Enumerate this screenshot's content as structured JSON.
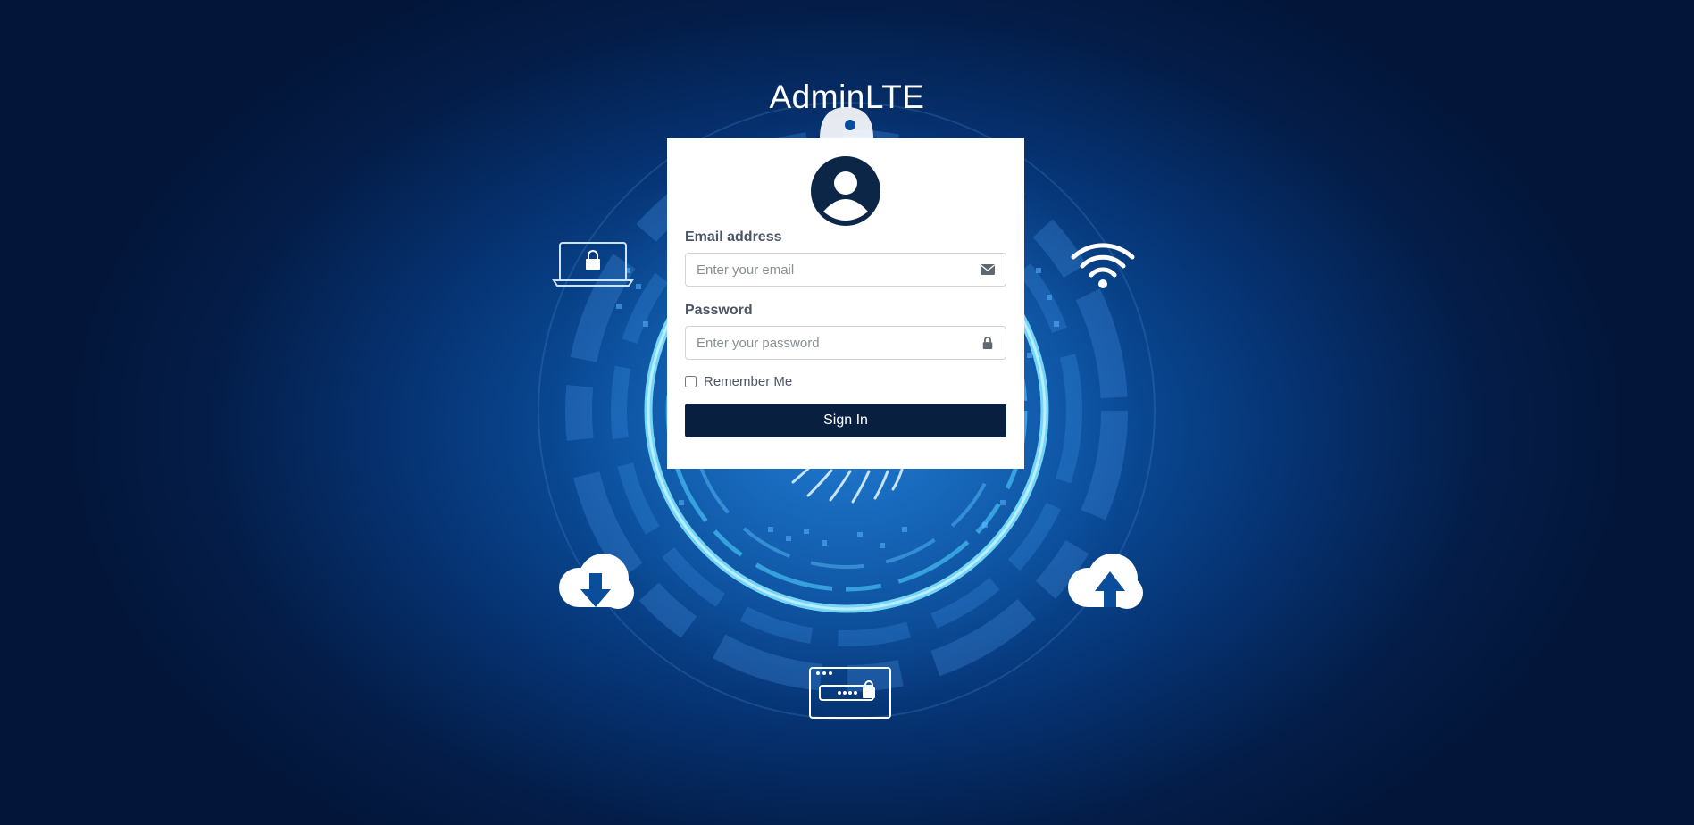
{
  "brand": {
    "title": "AdminLTE"
  },
  "login": {
    "avatar_icon": "user-circle-icon",
    "email": {
      "label": "Email address",
      "placeholder": "Enter your email",
      "value": "",
      "icon": "envelope-icon"
    },
    "password": {
      "label": "Password",
      "placeholder": "Enter your password",
      "value": "",
      "icon": "lock-icon"
    },
    "remember": {
      "label": "Remember Me",
      "checked": false
    },
    "submit_label": "Sign In"
  },
  "background": {
    "decor_icons": [
      "laptop-lock-icon",
      "wifi-icon",
      "cloud-download-icon",
      "cloud-upload-icon",
      "password-window-icon",
      "padlock-icon",
      "fingerprint-icon"
    ]
  },
  "colors": {
    "background_center": "#1266b8",
    "background_edge": "#03163a",
    "button": "#081f3f",
    "accent_glow": "#7fe3ff"
  }
}
